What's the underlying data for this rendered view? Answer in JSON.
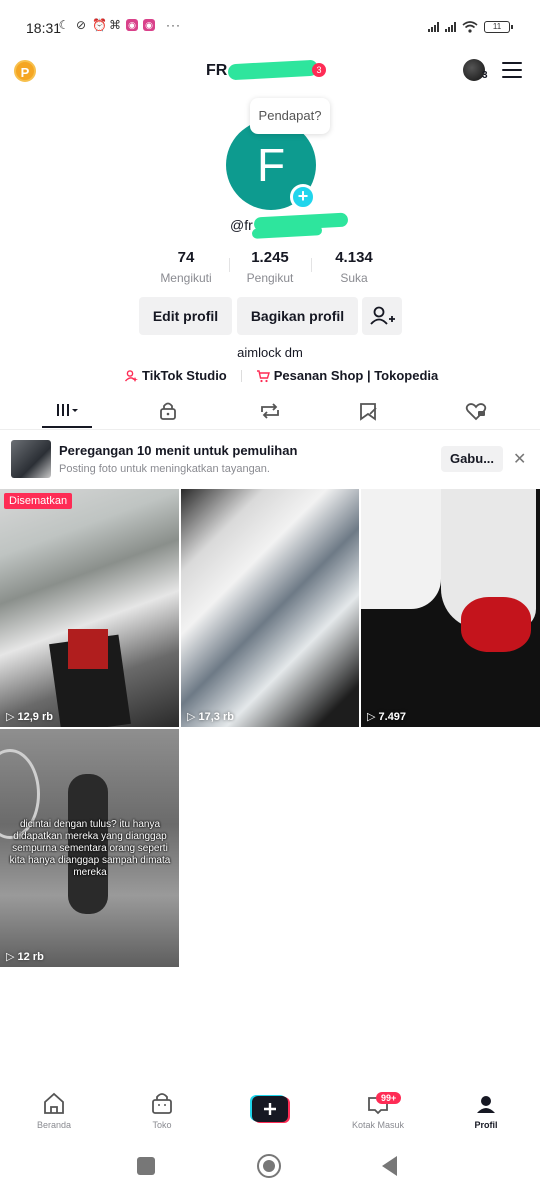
{
  "status_bar": {
    "time": "18:31",
    "battery": "11"
  },
  "header": {
    "username": "FR",
    "notification_count": "3",
    "account_count": "3"
  },
  "profile": {
    "avatar_letter": "F",
    "bubble_text": "Pendapat?",
    "handle": "@fr",
    "stats": [
      {
        "value": "74",
        "label": "Mengikuti"
      },
      {
        "value": "1.245",
        "label": "Pengikut"
      },
      {
        "value": "4.134",
        "label": "Suka"
      }
    ],
    "edit_button": "Edit profil",
    "share_button": "Bagikan profil",
    "bio": "aimlock dm",
    "link_studio": "TikTok Studio",
    "link_shop": "Pesanan Shop | Tokopedia"
  },
  "promo": {
    "title": "Peregangan 10 menit untuk pemulihan",
    "subtitle": "Posting foto untuk meningkatkan tayangan.",
    "button": "Gabu...",
    "close": "✕"
  },
  "videos": [
    {
      "views": "12,9 rb",
      "badge": "Disematkan"
    },
    {
      "views": "17,3 rb"
    },
    {
      "views": "7.497"
    },
    {
      "views": "12 rb",
      "caption": "dicintai dengan tulus? itu hanya didapatkan mereka yang dianggap sempurna sementara orang seperti kita hanya dianggap sampah dimata mereka"
    }
  ],
  "bottom_nav": {
    "home": "Beranda",
    "shop": "Toko",
    "inbox": "Kotak Masuk",
    "inbox_badge": "99+",
    "profile": "Profil"
  },
  "colors": {
    "accent": "#fe2c55",
    "teal": "#0d9b8f",
    "cyan": "#20d5ec"
  }
}
